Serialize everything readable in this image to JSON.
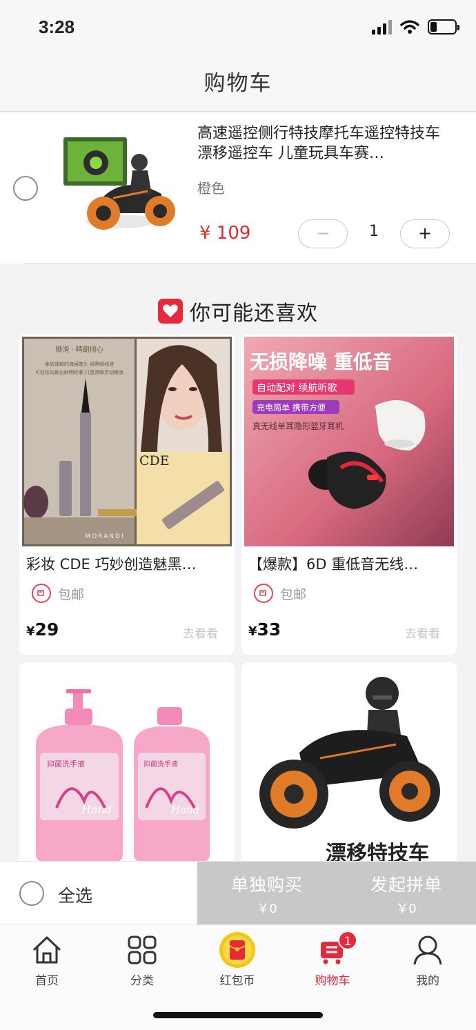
{
  "status_bar": {
    "time": "3:28"
  },
  "navbar": {
    "title": "购物车"
  },
  "cart_item": {
    "title": "高速遥控侧行特技摩托车遥控特技车漂移遥控车 儿童玩具车赛…",
    "spec": "橙色",
    "price": "¥ 109",
    "quantity": "1",
    "minus_label": "−",
    "plus_label": "+"
  },
  "recommend": {
    "title": "你可能还喜欢",
    "products": [
      {
        "title": "彩妆 CDE 巧妙创造魅黑…",
        "shipping": "包邮",
        "currency": "¥",
        "price": "29",
        "action": "去看看",
        "image_texts": {
          "tagline": "顺滑 · 晴朗倾心",
          "desc1": "柔软弹韧的海绵笔头 纯黑眼线液",
          "desc2": "可轻松勾勒出鲜明轮廓 打造清晰灵动眼妆",
          "brand": "CDE",
          "footer": "MORANDI"
        }
      },
      {
        "title": "【爆款】6D 重低音无线…",
        "shipping": "包邮",
        "currency": "¥",
        "price": "33",
        "action": "去看看",
        "image_texts": {
          "headline": "无损降噪 重低音",
          "tag1": "自动配对 续航听歌",
          "tag2": "充电简单 携带方便",
          "tag3": "真无线单耳隐形蓝牙耳机"
        }
      },
      {
        "title": "",
        "image_texts": {
          "label": "抑菌洗手液",
          "script": "Hand"
        }
      },
      {
        "title": "",
        "image_texts": {
          "headline": "漂移特技车"
        }
      }
    ]
  },
  "action_bar": {
    "select_all": "全选",
    "buy_alone": {
      "label": "单独购买",
      "amount": "￥0"
    },
    "group_buy": {
      "label": "发起拼单",
      "amount": "￥0"
    }
  },
  "tabbar": {
    "items": [
      {
        "label": "首页",
        "icon": "home-icon"
      },
      {
        "label": "分类",
        "icon": "grid-icon"
      },
      {
        "label": "红包币",
        "icon": "red-envelope-icon"
      },
      {
        "label": "购物车",
        "icon": "cart-icon",
        "badge": "1",
        "active": true
      },
      {
        "label": "我的",
        "icon": "user-icon"
      }
    ]
  },
  "colors": {
    "accent": "#e22b3a",
    "price": "#e02e2e",
    "disabled_button": "#c8c8c8"
  }
}
